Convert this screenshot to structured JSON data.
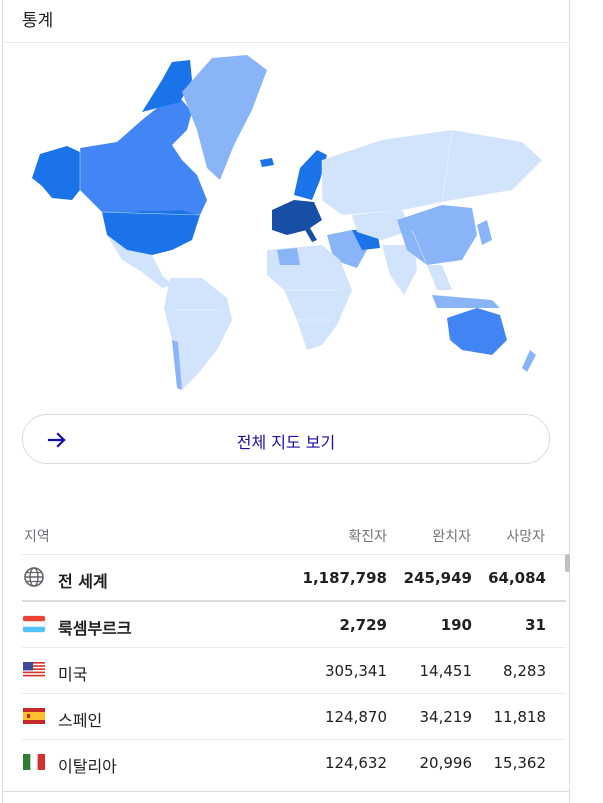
{
  "header": {
    "title": "통계"
  },
  "map": {
    "button_label": "전체 지도 보기"
  },
  "table": {
    "columns": {
      "region": "지역",
      "confirmed": "확진자",
      "recovered": "완치자",
      "deaths": "사망자"
    },
    "rows": [
      {
        "name": "전 세계",
        "confirmed": "1,187,798",
        "recovered": "245,949",
        "deaths": "64,084",
        "icon": "globe-icon"
      },
      {
        "name": "룩셈부르크",
        "confirmed": "2,729",
        "recovered": "190",
        "deaths": "31",
        "icon": "luxembourg-flag-icon"
      },
      {
        "name": "미국",
        "confirmed": "305,341",
        "recovered": "14,451",
        "deaths": "8,283",
        "icon": "usa-flag-icon"
      },
      {
        "name": "스페인",
        "confirmed": "124,870",
        "recovered": "34,219",
        "deaths": "11,818",
        "icon": "spain-flag-icon"
      },
      {
        "name": "이탈리아",
        "confirmed": "124,632",
        "recovered": "20,996",
        "deaths": "15,362",
        "icon": "italy-flag-icon"
      }
    ]
  },
  "colors": {
    "low": "#d2e3fc",
    "mid": "#8ab4f8",
    "high": "#4285f4",
    "higher": "#1a73e8",
    "highest": "#174ea6",
    "link": "#1a0dab"
  }
}
